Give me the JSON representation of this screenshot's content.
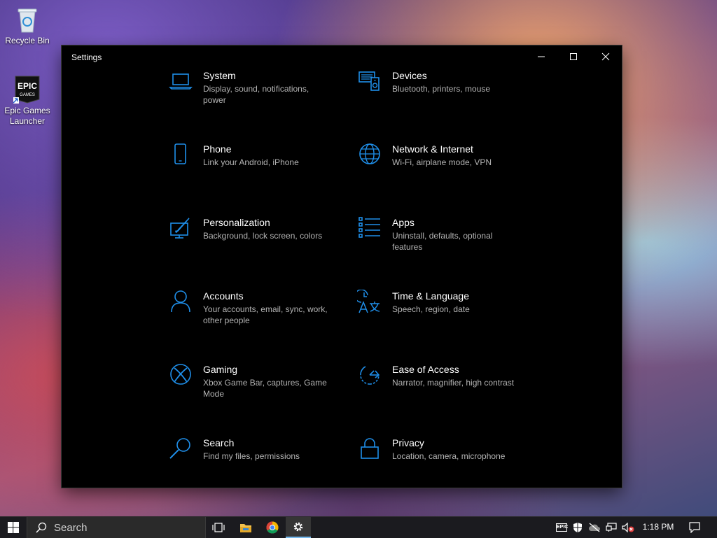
{
  "desktop": {
    "icons": [
      {
        "label": "Recycle Bin"
      },
      {
        "label": "Epic Games Launcher",
        "logo_text": "EPIC GAMES"
      }
    ]
  },
  "window": {
    "title": "Settings",
    "accent": "#1f8ee8",
    "controls": [
      "minimize-icon",
      "maximize-icon",
      "close-icon"
    ]
  },
  "settings": {
    "items": [
      {
        "title": "System",
        "desc": "Display, sound, notifications, power",
        "icon": "laptop-icon"
      },
      {
        "title": "Devices",
        "desc": "Bluetooth, printers, mouse",
        "icon": "devices-icon"
      },
      {
        "title": "Phone",
        "desc": "Link your Android, iPhone",
        "icon": "phone-icon"
      },
      {
        "title": "Network & Internet",
        "desc": "Wi-Fi, airplane mode, VPN",
        "icon": "globe-icon"
      },
      {
        "title": "Personalization",
        "desc": "Background, lock screen, colors",
        "icon": "paint-icon"
      },
      {
        "title": "Apps",
        "desc": "Uninstall, defaults, optional features",
        "icon": "apps-list-icon"
      },
      {
        "title": "Accounts",
        "desc": "Your accounts, email, sync, work, other people",
        "icon": "person-icon"
      },
      {
        "title": "Time & Language",
        "desc": "Speech, region, date",
        "icon": "time-language-icon"
      },
      {
        "title": "Gaming",
        "desc": "Xbox Game Bar, captures, Game Mode",
        "icon": "xbox-icon"
      },
      {
        "title": "Ease of Access",
        "desc": "Narrator, magnifier, high contrast",
        "icon": "ease-of-access-icon"
      },
      {
        "title": "Search",
        "desc": "Find my files, permissions",
        "icon": "search-icon"
      },
      {
        "title": "Privacy",
        "desc": "Location, camera, microphone",
        "icon": "lock-icon"
      }
    ]
  },
  "taskbar": {
    "search_label": "Search",
    "clock": "1:18 PM",
    "tray_epic_text": "EPIC",
    "apps": [
      "task-view-icon",
      "file-explorer-icon",
      "chrome-icon",
      "settings-gear-icon"
    ]
  }
}
